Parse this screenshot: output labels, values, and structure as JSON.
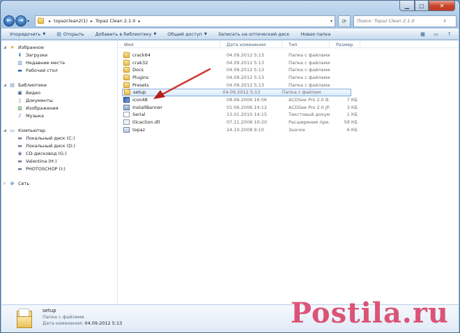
{
  "address": {
    "crumbs": [
      "topazclean2(1)",
      "Topaz Clean 2.1.0"
    ]
  },
  "search": {
    "placeholder": "Поиск: Topaz Clean 2.1.0"
  },
  "toolbar": {
    "organize": "Упорядочить",
    "open": "Открыть",
    "add_library": "Добавить в библиотеку",
    "share": "Общий доступ",
    "burn": "Записать на оптический диск",
    "new_folder": "Новая папка"
  },
  "nav": {
    "favorites": {
      "title": "Избранное",
      "items": [
        "Загрузки",
        "Недавние места",
        "Рабочий стол"
      ]
    },
    "libraries": {
      "title": "Библиотеки",
      "items": [
        "Видео",
        "Документы",
        "Изображения",
        "Музыка"
      ]
    },
    "computer": {
      "title": "Компьютер",
      "items": [
        "Локальный диск (C:)",
        "Локальный диск (D:)",
        "CD-дисковод (G:)",
        "Valentina (H:)",
        "PHOTOSCHOP (I:)"
      ]
    },
    "network": {
      "title": "Сеть"
    }
  },
  "columns": {
    "name": "Имя",
    "date": "Дата изменения",
    "type": "Тип",
    "size": "Размер"
  },
  "files": [
    {
      "name": "crack64",
      "date": "04.09.2012 5:13",
      "type": "Папка с файлами",
      "size": "",
      "icon": "folder"
    },
    {
      "name": "crak32",
      "date": "04.09.2012 5:13",
      "type": "Папка с файлами",
      "size": "",
      "icon": "folder"
    },
    {
      "name": "Docs",
      "date": "04.09.2012 5:13",
      "type": "Папка с файлами",
      "size": "",
      "icon": "folder"
    },
    {
      "name": "Plugins",
      "date": "04.09.2012 5:13",
      "type": "Папка с файлами",
      "size": "",
      "icon": "folder"
    },
    {
      "name": "Presets",
      "date": "04.09.2012 5:13",
      "type": "Папка с файлами",
      "size": "",
      "icon": "folder"
    },
    {
      "name": "setup",
      "date": "04.09.2012 5:13",
      "type": "Папка с файлами",
      "size": "",
      "icon": "folder"
    },
    {
      "name": "icon48",
      "date": "08.06.2006 16:06",
      "type": "ACDSee Pro 2.0 B...",
      "size": "7 КБ",
      "icon": "img"
    },
    {
      "name": "InstallBanner",
      "date": "01.06.2006 14:12",
      "type": "ACDSee Pro 2.0 JP...",
      "size": "3 КБ",
      "icon": "exe"
    },
    {
      "name": "Serial",
      "date": "13.01.2010 14:15",
      "type": "Текстовый докум...",
      "size": "1 КБ",
      "icon": "doc"
    },
    {
      "name": "tlicaction.dll",
      "date": "07.11.2008 10:20",
      "type": "Расширение при...",
      "size": "58 КБ",
      "icon": "dll"
    },
    {
      "name": "topaz",
      "date": "24.10.2008 9:10",
      "type": "Значок",
      "size": "6 КБ",
      "icon": "lnk"
    }
  ],
  "details": {
    "name": "setup",
    "type": "Папка с файлами",
    "modified_label": "Дата изменения:",
    "modified_value": "04.09.2012 5:13"
  },
  "watermark": "Postila.ru"
}
